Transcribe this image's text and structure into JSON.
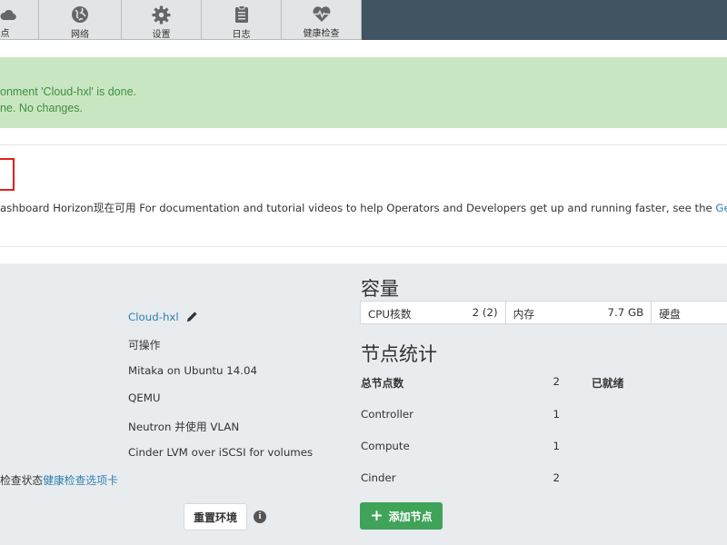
{
  "nav": {
    "tabs": [
      {
        "label": "点",
        "icon": "cloud-icon"
      },
      {
        "label": "网络",
        "icon": "globe-icon"
      },
      {
        "label": "设置",
        "icon": "gear-icon"
      },
      {
        "label": "日志",
        "icon": "clipboard-icon"
      },
      {
        "label": "健康检查",
        "icon": "heartbeat-icon"
      }
    ]
  },
  "alert": {
    "line1": "onment 'Cloud-hxl' is done.",
    "line2": "ne. No changes."
  },
  "info": {
    "text": "ashboard Horizon现在可用 For documentation and tutorial videos to help Operators and Developers get up and running faster, see the ",
    "link": "Get"
  },
  "environment": {
    "name": "Cloud-hxl",
    "status": "可操作",
    "release": "Mitaka on Ubuntu 14.04",
    "hypervisor": "QEMU",
    "network": "Neutron 并使用 VLAN",
    "storage": "Cinder LVM over iSCSI for volumes",
    "health_prefix": "检查状态",
    "health_link": "健康检查选项卡",
    "reset_button": "重置环境"
  },
  "capacity": {
    "title": "容量",
    "cpu_label": "CPU核数",
    "cpu_value": "2 (2)",
    "mem_label": "内存",
    "mem_value": "7.7 GB",
    "disk_label": "硬盘"
  },
  "node_stats": {
    "title": "节点统计",
    "total_label": "总节点数",
    "total_value": "2",
    "ready_label": "已就绪",
    "rows": [
      {
        "label": "Controller",
        "value": "1"
      },
      {
        "label": "Compute",
        "value": "1"
      },
      {
        "label": "Cinder",
        "value": "2"
      }
    ],
    "add_button": "添加节点"
  },
  "colors": {
    "topbar": "#415462",
    "alert_bg": "#c9e6c3",
    "alert_text": "#3f8f3f",
    "link": "#2f7fb0",
    "add_button": "#3fa35a",
    "env_bg": "#e9ecee"
  }
}
